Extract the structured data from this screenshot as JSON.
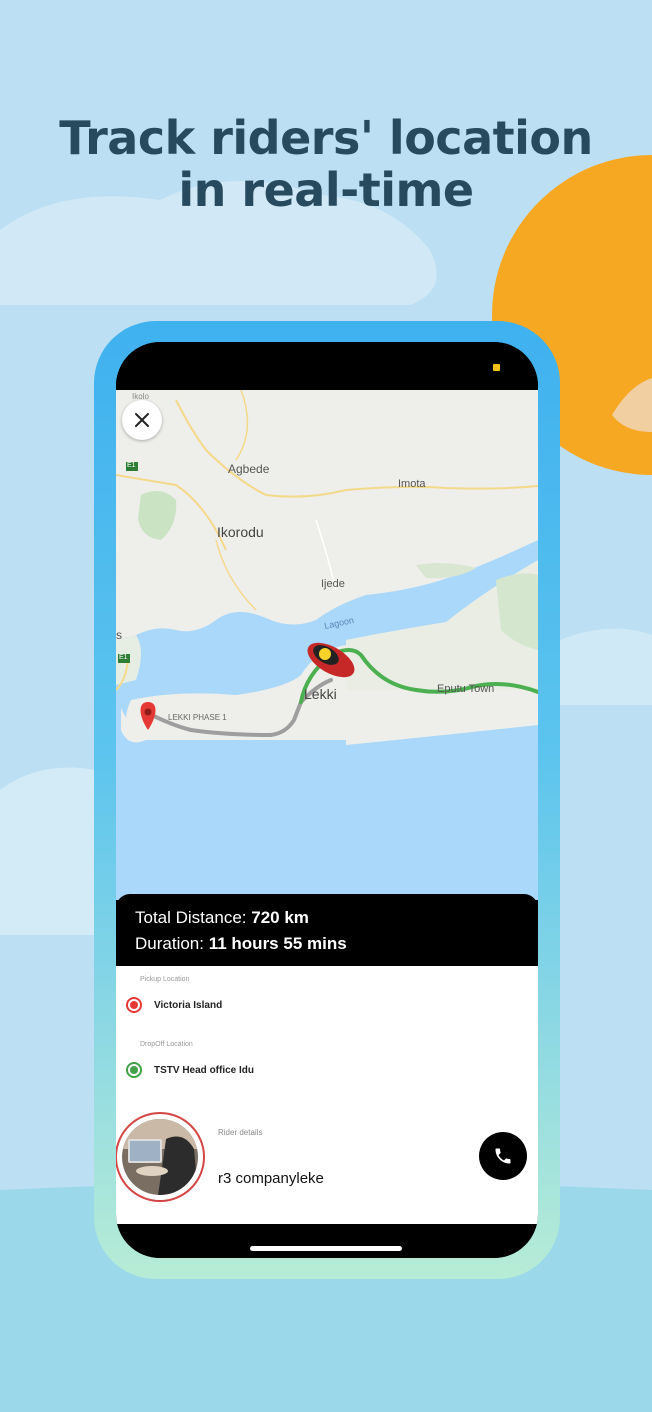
{
  "promo": {
    "headline_line1": "Track riders' location",
    "headline_line2": "in real-time"
  },
  "map": {
    "labels": {
      "agbede": "Agbede",
      "imota": "Imota",
      "ikorodu": "Ikorodu",
      "ijede": "Ijede",
      "lagoon": "Lagoon",
      "lekki": "Lekki",
      "eputu_town": "Eputu Town",
      "lekki_phase_1": "LEKKI PHASE 1",
      "ikorodu_top": "Ikolo",
      "road_e1_top": "E1",
      "road_e1_mid": "E1",
      "edge_s": "s"
    },
    "icons": {
      "close": "close-icon",
      "pin": "map-pin-icon",
      "rider": "motorbike-rider-icon"
    }
  },
  "trip": {
    "distance_label": "Total Distance:",
    "distance_value": "720 km",
    "duration_label": "Duration:",
    "duration_value": "11 hours 55 mins"
  },
  "locations": {
    "pickup_caption": "Pickup Location",
    "pickup_name": "Victoria Island",
    "dropoff_caption": "DropOff Location",
    "dropoff_name": "TSTV Head office Idu"
  },
  "rider": {
    "caption": "Rider details",
    "name": "r3 companyleke",
    "call_icon": "phone-icon"
  },
  "colors": {
    "headline": "#274a5e",
    "route_green": "#4caf50",
    "route_grey": "#9e9e9e",
    "pickup_red": "#e53935",
    "dropoff_green": "#43a047",
    "sun": "#f7a823"
  }
}
